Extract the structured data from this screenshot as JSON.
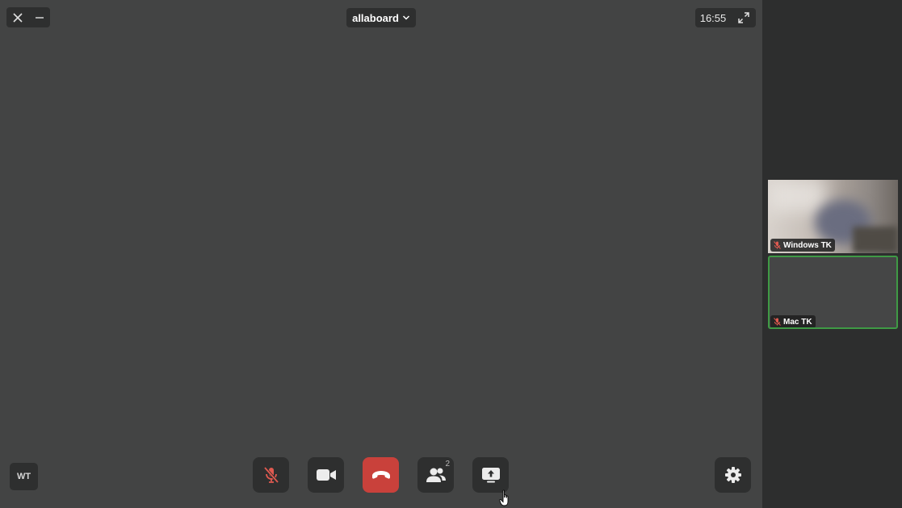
{
  "window": {
    "close_icon": "close-icon",
    "minimize_icon": "minimize-icon"
  },
  "room": {
    "name": "allaboard",
    "dropdown_icon": "chevron-down-icon"
  },
  "status": {
    "time": "16:55",
    "fullscreen_icon": "expand-icon"
  },
  "self": {
    "initials": "WT"
  },
  "controls": {
    "mic_icon": "mic-muted-icon",
    "camera_icon": "camera-icon",
    "hangup_icon": "phone-hangup-icon",
    "participants_icon": "participants-icon",
    "participants_count": "2",
    "share_icon": "screen-share-icon",
    "settings_icon": "gear-icon"
  },
  "participants": [
    {
      "name": "Windows TK",
      "muted": true
    },
    {
      "name": "Mac TK",
      "muted": true,
      "active": true
    }
  ],
  "colors": {
    "stage": "#434444",
    "sidebar": "#2d2e2e",
    "hangup": "#c9413b",
    "active_border": "#3f9a45",
    "muted_icon": "#e05a50"
  }
}
